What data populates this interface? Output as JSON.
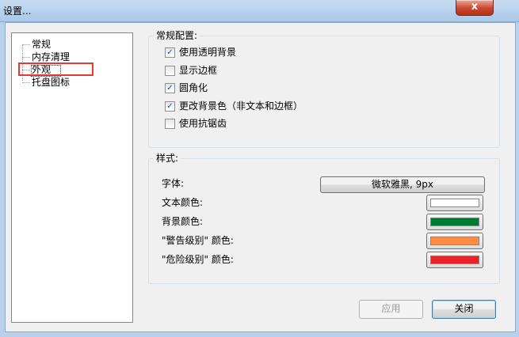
{
  "window": {
    "title": "设置...",
    "close_label": "x"
  },
  "tree": {
    "items": [
      {
        "label": "常规"
      },
      {
        "label": "内存清理"
      },
      {
        "label": "外观"
      },
      {
        "label": "托盘图标"
      }
    ],
    "selected": "外观"
  },
  "general": {
    "title": "常规配置:",
    "options": [
      {
        "label": "使用透明背景",
        "checked": true
      },
      {
        "label": "显示边框",
        "checked": false
      },
      {
        "label": "圆角化",
        "checked": true
      },
      {
        "label": "更改背景色（非文本和边框）",
        "checked": true
      },
      {
        "label": "使用抗锯齿",
        "checked": false
      }
    ]
  },
  "style": {
    "title": "样式:",
    "font_label": "字体:",
    "font_value": "微软雅黑, 9px",
    "text_color_label": "文本颜色:",
    "bg_color_label": "背景颜色:",
    "warn_color_label": "\"警告级别\" 颜色:",
    "danger_color_label": "\"危险级别\" 颜色:",
    "colors": {
      "text": "#ffffff",
      "background": "#007a33",
      "warning": "#ff8c42",
      "danger": "#e8232a"
    }
  },
  "buttons": {
    "apply": "应用",
    "close": "关闭"
  }
}
